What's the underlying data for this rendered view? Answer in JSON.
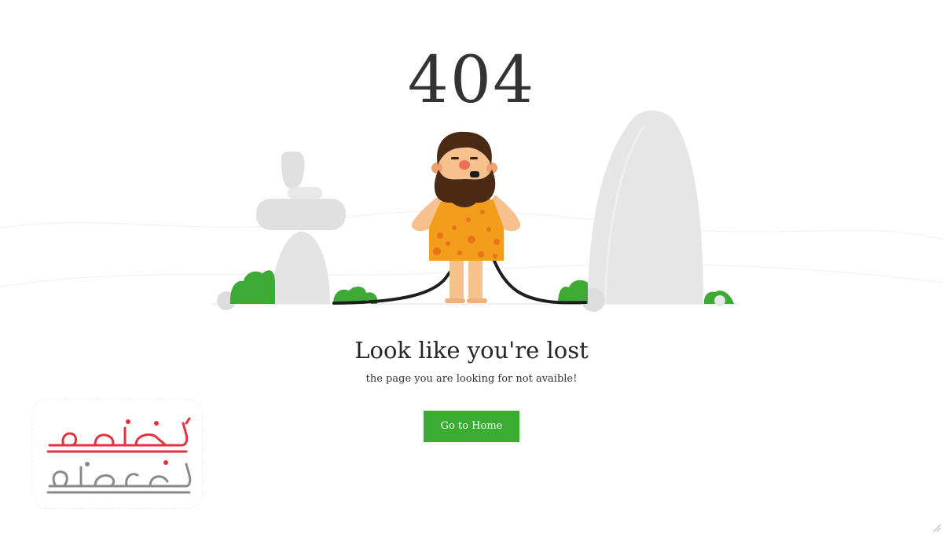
{
  "error_code": "404",
  "title": "Look like you're lost",
  "subtitle": "the page you are looking for not avaible!",
  "home_button_label": "Go to Home",
  "logo": {
    "text": "برنامه نویسان",
    "colors": {
      "red": "#e2323a",
      "gray": "#8a8a8a"
    }
  },
  "colors": {
    "accent_green": "#39ac31",
    "rock_gray": "#e4e4e4",
    "leaf_green": "#3daa35",
    "tunic_orange": "#f29d1b",
    "beard_brown": "#4a2a14",
    "skin": "#f7c08f"
  },
  "icons": [
    "caveman-illustration",
    "rock-icon",
    "bush-icon",
    "cable-icon",
    "resize-handle-icon",
    "logo-mark"
  ]
}
